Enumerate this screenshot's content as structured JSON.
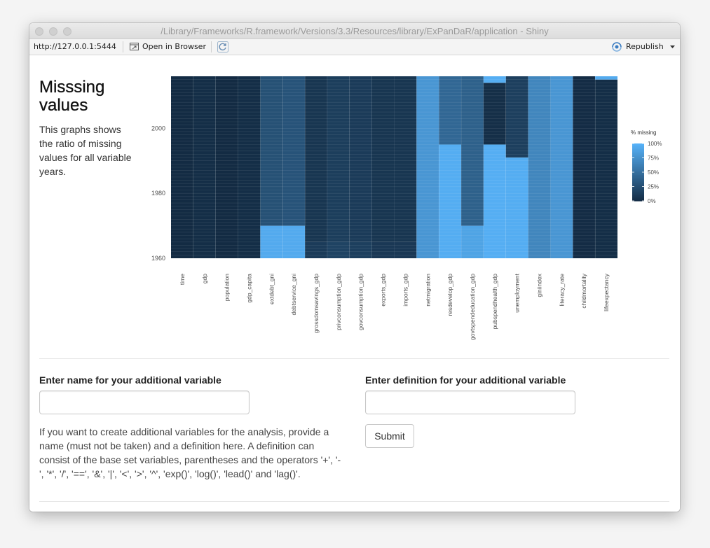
{
  "window": {
    "title": "/Library/Frameworks/R.framework/Versions/3.3/Resources/library/ExPanDaR/application - Shiny"
  },
  "toolbar": {
    "url": "http://127.0.0.1:5444",
    "open_in_browser": "Open in Browser",
    "republish": "Republish",
    "icons": [
      "open-browser-icon",
      "refresh-icon",
      "republish-icon",
      "dropdown-caret-icon"
    ]
  },
  "section": {
    "title": "Misssing values",
    "description": "This graphs shows the ratio of missing values for all variable years."
  },
  "form": {
    "name_label": "Enter name for your additional variable",
    "name_value": "",
    "definition_label": "Enter definition for your additional variable",
    "definition_value": "",
    "submit_label": "Submit",
    "help_text": "If you want to create additional variables for the analysis, provide a name (must not be taken) and a definition here. A definition can consist of the base set variables, parentheses and the operators '+', '-', '*', '/', '==', '&', '|', '<', '>', '^', 'exp()', 'log()', 'lead()' and 'lag()'."
  },
  "colors": {
    "low": "#132B43",
    "high": "#56B1F7"
  },
  "chart_data": {
    "type": "heatmap",
    "x": [
      "time",
      "gdp",
      "population",
      "gdp_capita",
      "extdebt_gni",
      "debtservice_gni",
      "grossdomsavings_gdp",
      "privconsumption_gdp",
      "govconsumption_gdp",
      "exports_gdp",
      "imports_gdp",
      "netmigration",
      "resdevelop_gdp",
      "govtspendeducation_gdp",
      "pubspendhealth_gdp",
      "unemployment",
      "giniindex",
      "literacy_rate",
      "childmortality",
      "lifeexpectancy"
    ],
    "ylim": [
      1960,
      2016
    ],
    "y_ticks": [
      1960,
      1980,
      2000
    ],
    "legend": {
      "title": "% missing",
      "labels": [
        "100%",
        "75%",
        "50%",
        "25%",
        "0%"
      ],
      "placement": "right"
    },
    "note": "",
    "series": [
      {
        "name": "time",
        "segments": [
          [
            1960,
            2016,
            0.0
          ]
        ]
      },
      {
        "name": "gdp",
        "segments": [
          [
            1960,
            2016,
            0.02
          ]
        ]
      },
      {
        "name": "population",
        "segments": [
          [
            1960,
            2016,
            0.0
          ]
        ]
      },
      {
        "name": "gdp_capita",
        "segments": [
          [
            1960,
            2016,
            0.02
          ]
        ]
      },
      {
        "name": "extdebt_gni",
        "segments": [
          [
            1960,
            1970,
            0.95
          ],
          [
            1970,
            2016,
            0.28
          ]
        ]
      },
      {
        "name": "debtservice_gni",
        "segments": [
          [
            1960,
            1970,
            0.95
          ],
          [
            1970,
            2016,
            0.3
          ]
        ]
      },
      {
        "name": "grossdomsavings_gdp",
        "segments": [
          [
            1960,
            1965,
            0.12
          ],
          [
            1965,
            2016,
            0.08
          ]
        ]
      },
      {
        "name": "privconsumption_gdp",
        "segments": [
          [
            1960,
            1965,
            0.18
          ],
          [
            1965,
            2016,
            0.14
          ]
        ]
      },
      {
        "name": "govconsumption_gdp",
        "segments": [
          [
            1960,
            1965,
            0.15
          ],
          [
            1965,
            2016,
            0.12
          ]
        ]
      },
      {
        "name": "exports_gdp",
        "segments": [
          [
            1960,
            1965,
            0.1
          ],
          [
            1965,
            2016,
            0.08
          ]
        ]
      },
      {
        "name": "imports_gdp",
        "segments": [
          [
            1960,
            1965,
            0.1
          ],
          [
            1965,
            2016,
            0.08
          ]
        ]
      },
      {
        "name": "netmigration",
        "segments": [
          [
            1960,
            2016,
            0.8
          ]
        ]
      },
      {
        "name": "resdevelop_gdp",
        "segments": [
          [
            1960,
            1995,
            0.97
          ],
          [
            1995,
            2016,
            0.45
          ]
        ]
      },
      {
        "name": "govtspendeducation_gdp",
        "segments": [
          [
            1960,
            1970,
            0.9
          ],
          [
            1970,
            2016,
            0.4
          ]
        ]
      },
      {
        "name": "pubspendhealth_gdp",
        "segments": [
          [
            1960,
            1995,
            0.98
          ],
          [
            1995,
            2014,
            0.03
          ],
          [
            2014,
            2016,
            0.98
          ]
        ]
      },
      {
        "name": "unemployment",
        "segments": [
          [
            1960,
            1991,
            0.97
          ],
          [
            1991,
            2016,
            0.15
          ]
        ]
      },
      {
        "name": "giniindex",
        "segments": [
          [
            1960,
            2016,
            0.68
          ]
        ]
      },
      {
        "name": "literacy_rate",
        "segments": [
          [
            1960,
            2016,
            0.8
          ]
        ]
      },
      {
        "name": "childmortality",
        "segments": [
          [
            1960,
            2016,
            0.01
          ]
        ]
      },
      {
        "name": "lifeexpectancy",
        "segments": [
          [
            1960,
            2015,
            0.02
          ],
          [
            2015,
            2016,
            0.95
          ]
        ]
      }
    ]
  }
}
